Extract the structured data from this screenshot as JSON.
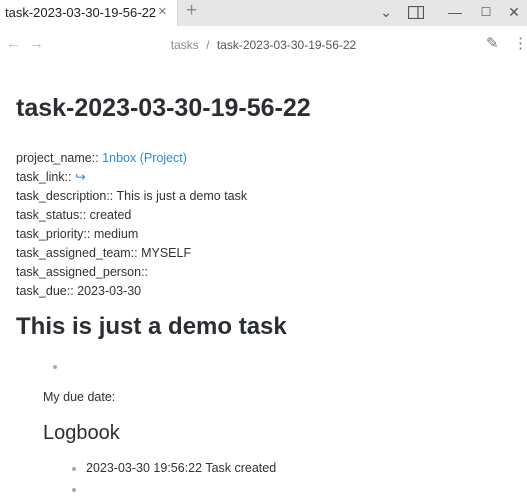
{
  "tab": {
    "title": "task-2023-03-30-19-56-22",
    "close": "×",
    "new": "+"
  },
  "window": {
    "dropdown": "⌄",
    "minimize": "—",
    "maximize": "☐",
    "close": "✕"
  },
  "nav": {
    "back": "←",
    "forward": "→",
    "breadcrumb": {
      "folder": "tasks",
      "separator": "/",
      "current": "task-2023-03-30-19-56-22"
    },
    "edit": "✎",
    "more": "⋮"
  },
  "note": {
    "title": "task-2023-03-30-19-56-22",
    "properties": [
      {
        "key": "project_name:: ",
        "value": "1nbox (Project)",
        "is_link": true
      },
      {
        "key": "task_link:: ",
        "value": "↪",
        "is_link": true
      },
      {
        "key": "task_description:: ",
        "value": "This is just a demo task",
        "is_link": false
      },
      {
        "key": "task_status:: ",
        "value": "created",
        "is_link": false
      },
      {
        "key": "task_priority:: ",
        "value": "medium",
        "is_link": false
      },
      {
        "key": "task_assigned_team:: ",
        "value": "MYSELF",
        "is_link": false
      },
      {
        "key": "task_assigned_person:: ",
        "value": "",
        "is_link": false
      },
      {
        "key": "task_due:: ",
        "value": "2023-03-30",
        "is_link": false
      }
    ],
    "heading": "This is just a demo task",
    "due_label": "My due date:",
    "logbook_heading": "Logbook",
    "log_entries": [
      "2023-03-30 19:56:22 Task created",
      ""
    ]
  },
  "colors": {
    "link": "#2b8ad3",
    "tabbar": "#e6e6e6",
    "text": "#2e3338"
  }
}
